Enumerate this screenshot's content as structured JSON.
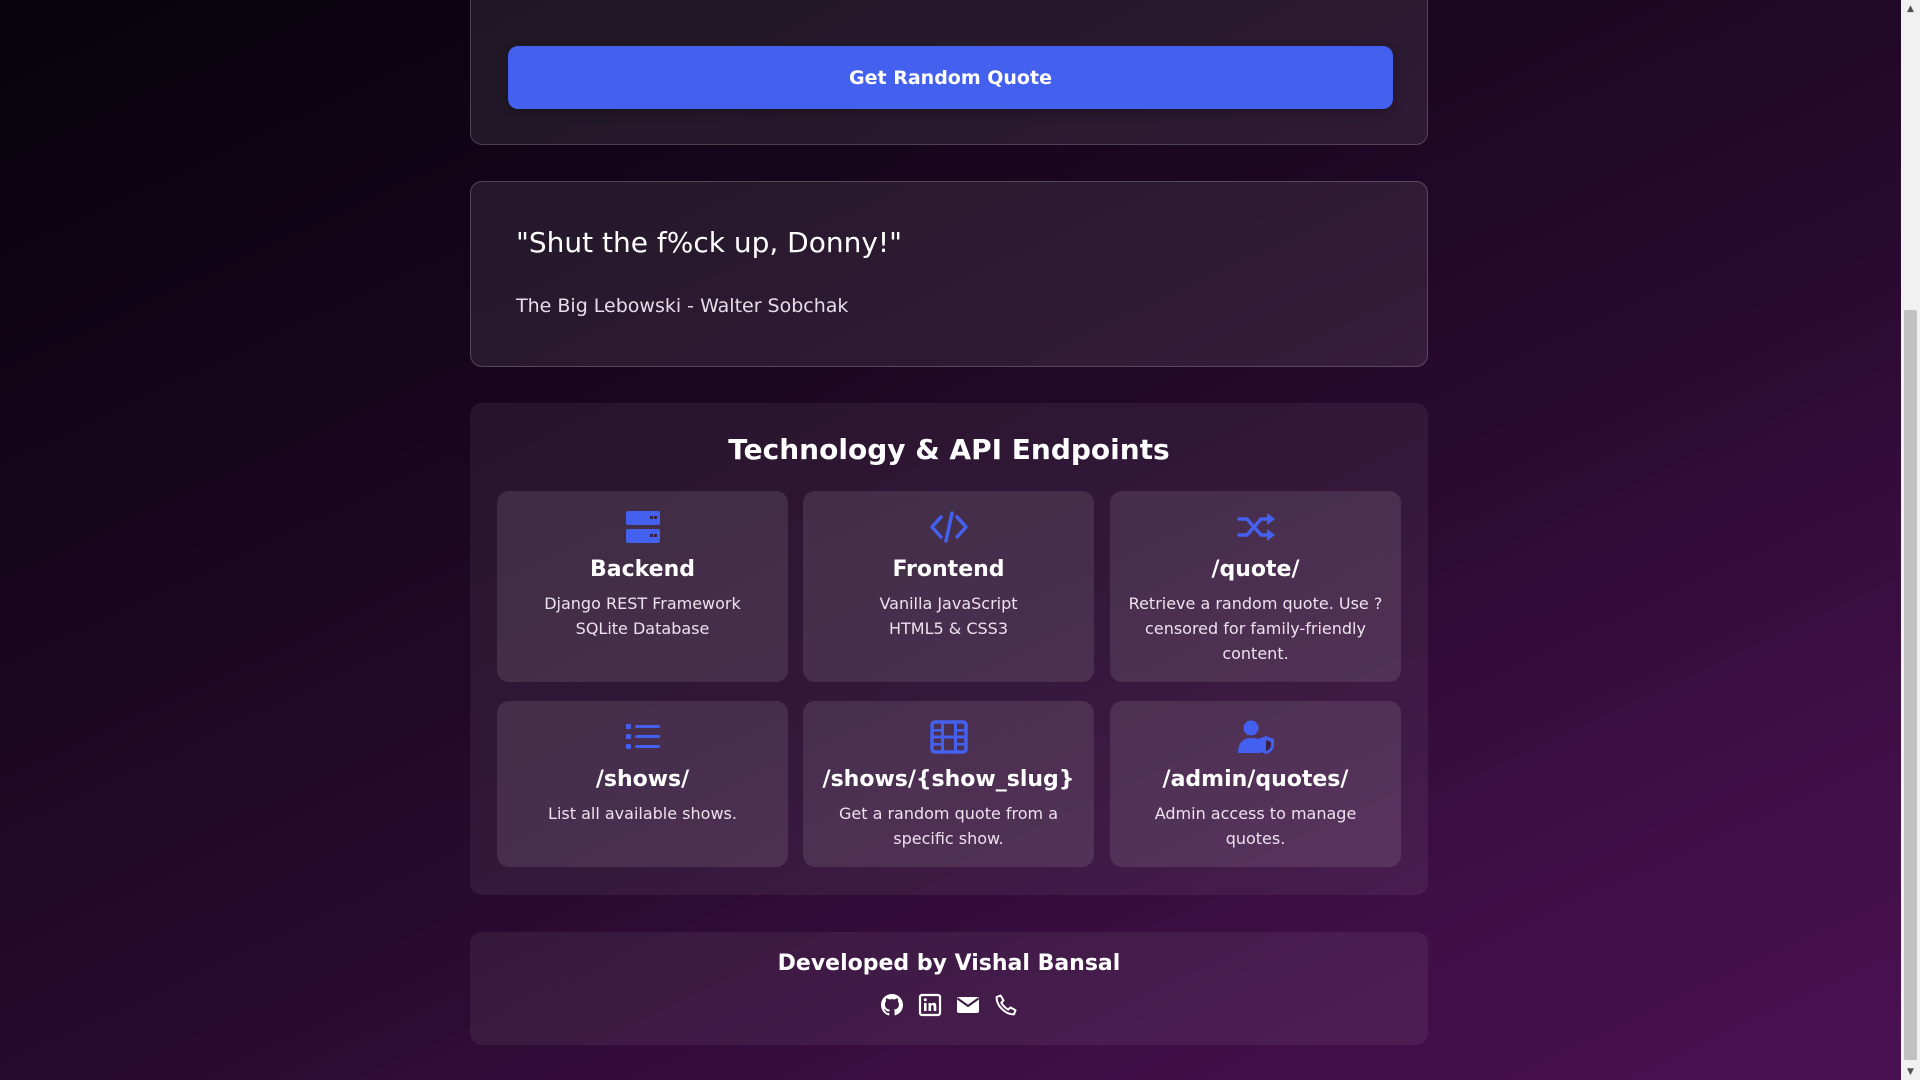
{
  "controls": {
    "get_quote_label": "Get Random Quote"
  },
  "quote": {
    "text": "\"Shut the f%ck up, Donny!\"",
    "source": "The Big Lebowski  - Walter Sobchak"
  },
  "tech": {
    "title": "Technology & API Endpoints",
    "cards": [
      {
        "icon": "server-icon",
        "title": "Backend",
        "lines": [
          "Django REST Framework",
          "SQLite Database"
        ]
      },
      {
        "icon": "code-icon",
        "title": "Frontend",
        "lines": [
          "Vanilla JavaScript",
          "HTML5 & CSS3"
        ]
      },
      {
        "icon": "shuffle-icon",
        "title": "/quote/",
        "lines": [
          "Retrieve a random quote. Use ?censored for family-friendly content."
        ]
      },
      {
        "icon": "list-icon",
        "title": "/shows/",
        "lines": [
          "List all available shows."
        ]
      },
      {
        "icon": "film-icon",
        "title": "/shows/{show_slug}",
        "lines": [
          "Get a random quote from a specific show."
        ]
      },
      {
        "icon": "user-shield-icon",
        "title": "/admin/quotes/",
        "lines": [
          "Admin access to manage quotes."
        ]
      }
    ]
  },
  "footer": {
    "credit": "Developed by Vishal Bansal",
    "social": [
      "github-icon",
      "linkedin-icon",
      "email-icon",
      "phone-icon"
    ]
  },
  "colors": {
    "accent": "#4361ee",
    "icon": "#4361ee",
    "bg_dark": "#06030a",
    "bg_purple": "#4b1152"
  }
}
